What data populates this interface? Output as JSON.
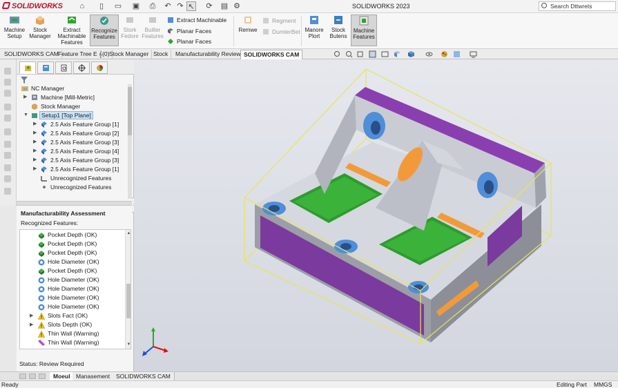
{
  "app": {
    "brand": "SOLIDWORKS",
    "window_title": "SOLIDWORKS 2023",
    "search_placeholder": "Search Dttwrets"
  },
  "ribbon": {
    "machine_setup": "Machine Setup",
    "stock_manager": "Stock Manager",
    "extract_machinable_features": "Extract Machinable Features",
    "recognize_features": "Recognize Features",
    "stork_fedore": "Stork Fedore",
    "builter_features": "Builter Features",
    "extract_machinable": "Extract Machinable",
    "planar_faces_1": "Planar Faces",
    "planar_faces_2": "Planar Faces",
    "remwe": "Remwe",
    "regment": "Regment",
    "dumterbet": "DumterBet",
    "manore_plort": "Manore Plort",
    "stock_butens": "Stock Butens",
    "machine_features": "Machine Features"
  },
  "command_tabs": [
    "SOLIDWORKS CAM",
    "Feature Tree E 𝄞(0)",
    "Stock Manager",
    "Stock",
    "Manufacturability Review",
    "SOLIDWORKS CAM"
  ],
  "tree": {
    "root": "NC Manager",
    "machine": "Machine [Mill-Metric]",
    "stock": "Stock Manager",
    "setup": "Setup1 [Top Plane]",
    "groups": [
      "2.5 Axis Feature Group [1]",
      "2.5 Axis Feature Group [2]",
      "2.5 Axis Feature Group [3]",
      "2.5 Axis Feature Group [4]",
      "2.5 Axis Feature Group [3]",
      "2.5 Axis Feature Group [1]"
    ],
    "unrecognized_1": "Unrecognized Features",
    "unrecognized_2": "Unrecognized Features"
  },
  "assessment": {
    "title": "Manufacturability Assessment",
    "subtitle": "Recognized Features:",
    "items": [
      {
        "label": "Pocket Depth (OK)",
        "icon": "pocket-icon",
        "expandable": false
      },
      {
        "label": "Pocket Depth (OK)",
        "icon": "pocket-icon",
        "expandable": false
      },
      {
        "label": "Pocket Depth (OK)",
        "icon": "pocket-icon",
        "expandable": false
      },
      {
        "label": "Hole Diameter (OK)",
        "icon": "hole-icon",
        "expandable": false
      },
      {
        "label": "Pocket Depth (OK)",
        "icon": "pocket-icon",
        "expandable": false
      },
      {
        "label": "Hole Diameter (OK)",
        "icon": "hole-icon",
        "expandable": false
      },
      {
        "label": "Hole Diameter (OK)",
        "icon": "hole-icon",
        "expandable": false
      },
      {
        "label": "Hole Diameter (OK)",
        "icon": "hole-icon",
        "expandable": false
      },
      {
        "label": "Hole Diameter (OK)",
        "icon": "hole-icon",
        "expandable": false
      },
      {
        "label": "Slots Fact (OK)",
        "icon": "warning-icon",
        "expandable": true
      },
      {
        "label": "Slots Depth (OK)",
        "icon": "warning-icon",
        "expandable": true
      },
      {
        "label": "Thin Wall (Warning)",
        "icon": "warning-icon",
        "expandable": false
      },
      {
        "label": "Thin Wall (Warning)",
        "icon": "thin-wall-icon",
        "expandable": false
      }
    ],
    "status": "Status:  Review Required"
  },
  "bottom_tabs": [
    "Moeul",
    "Manasement",
    "SOLIDWORKS CAM"
  ],
  "statusbar": {
    "left": "Ready",
    "mode": "Editing Part",
    "units": "MMGS"
  },
  "colors": {
    "pocket": "#2fa52f",
    "hole": "#4f8ed8",
    "slot": "#f29a3a",
    "thin_wall": "#8a3fb0",
    "stock_box": "#e8e45a",
    "part_gray": "#c8cbd2",
    "brand_red": "#c8102e"
  }
}
